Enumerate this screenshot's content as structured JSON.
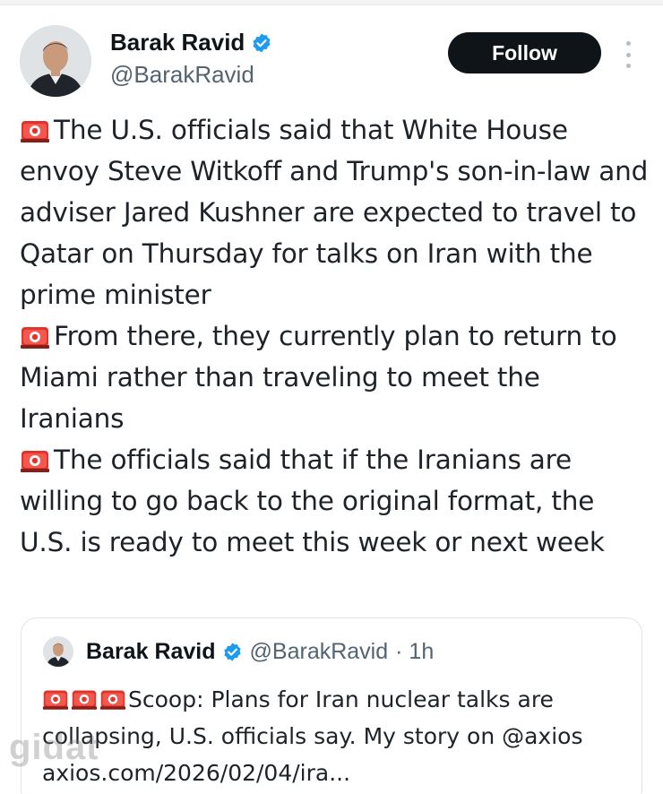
{
  "author": {
    "name": "Barak Ravid",
    "handle": "@BarakRavid",
    "verified": true,
    "avatar_icon": "profile-photo"
  },
  "actions": {
    "follow_label": "Follow",
    "more_icon": "vertical-ellipsis-icon"
  },
  "tweet": {
    "paragraphs": [
      {
        "emoji": "police-car-light",
        "text": "The U.S. officials said that White House envoy Steve Witkoff and Trump's son-in-law and adviser Jared Kushner are expected to travel to Qatar on Thursday for talks on Iran with the prime minister"
      },
      {
        "emoji": "police-car-light",
        "text": "From there, they currently plan to return to Miami rather than traveling to meet the Iranians"
      },
      {
        "emoji": "police-car-light",
        "text": "The officials said that if the Iranians are willing to go back to the original format, the U.S. is ready to meet this week or next week"
      }
    ]
  },
  "quoted_tweet": {
    "name": "Barak Ravid",
    "handle": "@BarakRavid",
    "time": "· 1h",
    "verified": true,
    "emoji_count": 3,
    "text": "Scoop: Plans for Iran nuclear talks are collapsing, U.S. officials say. My story on @axios",
    "link": "axios.com/2026/02/04/ira..."
  },
  "watermark": {
    "text": "gidat"
  },
  "colors": {
    "accent_blue": "#1d9bf0",
    "siren_red": "#e0342b",
    "follow_bg": "#0f1419"
  }
}
